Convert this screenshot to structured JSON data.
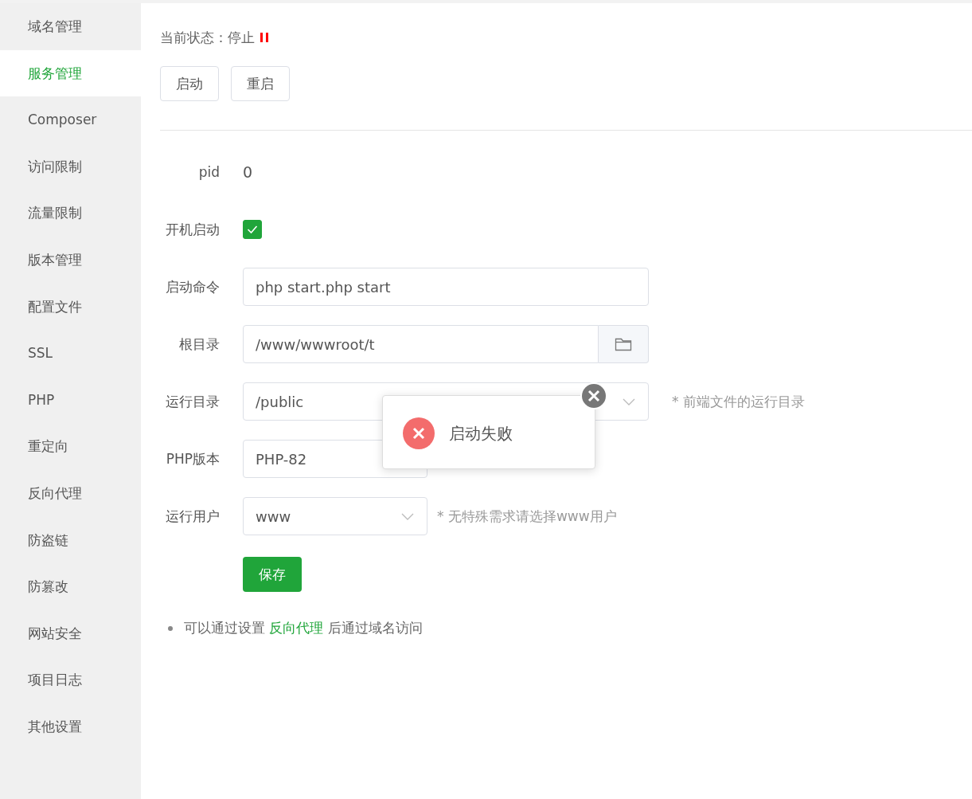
{
  "sidebar": {
    "items": [
      {
        "label": "域名管理",
        "selected": false
      },
      {
        "label": "服务管理",
        "selected": true
      },
      {
        "label": "Composer",
        "selected": false
      },
      {
        "label": "访问限制",
        "selected": false
      },
      {
        "label": "流量限制",
        "selected": false
      },
      {
        "label": "版本管理",
        "selected": false
      },
      {
        "label": "配置文件",
        "selected": false
      },
      {
        "label": "SSL",
        "selected": false
      },
      {
        "label": "PHP",
        "selected": false
      },
      {
        "label": "重定向",
        "selected": false
      },
      {
        "label": "反向代理",
        "selected": false
      },
      {
        "label": "防盗链",
        "selected": false
      },
      {
        "label": "防篡改",
        "selected": false
      },
      {
        "label": "网站安全",
        "selected": false
      },
      {
        "label": "项目日志",
        "selected": false
      },
      {
        "label": "其他设置",
        "selected": false
      }
    ]
  },
  "status": {
    "label": "当前状态：",
    "value": "停止",
    "running": false
  },
  "actions": [
    "启动",
    "重启"
  ],
  "form": {
    "rows": [
      {
        "kind": "text",
        "label": "pid",
        "value": "0"
      },
      {
        "kind": "checkbox",
        "label": "开机启动",
        "checked": true
      },
      {
        "kind": "input",
        "label": "启动命令",
        "value": "php start.php start"
      },
      {
        "kind": "browse",
        "label": "根目录",
        "value": "/www/wwwroot/t"
      },
      {
        "kind": "wideselect",
        "label": "运行目录",
        "value": "/public",
        "hint": "* 前端文件的运行目录"
      },
      {
        "kind": "select",
        "label": "PHP版本",
        "value": "PHP-82",
        "covered": true
      },
      {
        "kind": "select",
        "label": "运行用户",
        "value": "www",
        "hint": "* 无特殊需求请选择www用户"
      }
    ],
    "save": "保存"
  },
  "note": {
    "before": "可以通过设置 ",
    "link": "反向代理",
    "after": " 后通过域名访问"
  },
  "toast": {
    "message": "启动失败"
  }
}
